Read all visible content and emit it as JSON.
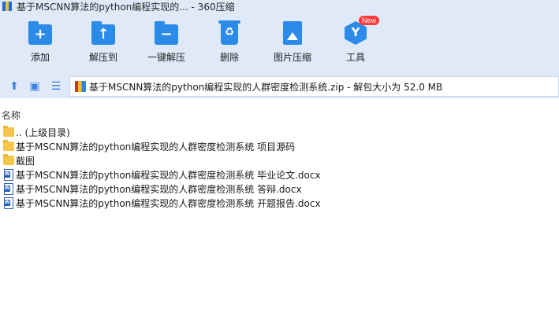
{
  "window": {
    "title": "基于MSCNN算法的python编程实现的... - 360压缩"
  },
  "toolbar": {
    "items": [
      {
        "label": "添加",
        "icon": "add-icon"
      },
      {
        "label": "解压到",
        "icon": "extract-to-icon"
      },
      {
        "label": "一键解压",
        "icon": "one-click-extract-icon"
      },
      {
        "label": "删除",
        "icon": "delete-icon"
      },
      {
        "label": "图片压缩",
        "icon": "image-compress-icon"
      },
      {
        "label": "工具",
        "icon": "tools-icon",
        "badge": "New"
      }
    ]
  },
  "address": {
    "path": "基于MSCNN算法的python编程实现的人群密度检测系统.zip - 解包大小为 52.0 MB"
  },
  "list": {
    "column_name": "名称",
    "rows": [
      {
        "name": ".. (上级目录)",
        "type": "folder"
      },
      {
        "name": "基于MSCNN算法的python编程实现的人群密度检测系统 项目源码",
        "type": "folder"
      },
      {
        "name": "截图",
        "type": "folder"
      },
      {
        "name": "基于MSCNN算法的python编程实现的人群密度检测系统 毕业论文.docx",
        "type": "docx"
      },
      {
        "name": "基于MSCNN算法的python编程实现的人群密度检测系统 答辩.docx",
        "type": "docx"
      },
      {
        "name": "基于MSCNN算法的python编程实现的人群密度检测系统 开题报告.docx",
        "type": "docx"
      }
    ]
  },
  "colors": {
    "accent": "#2c8ae8",
    "toolbar_bg": "#dfe9f7",
    "badge": "#ff3b3b"
  }
}
